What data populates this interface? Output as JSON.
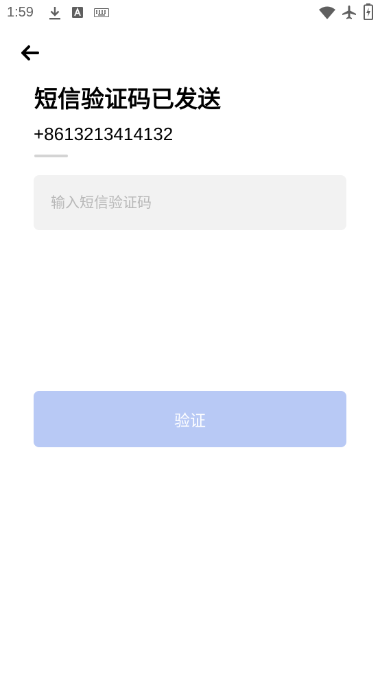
{
  "status_bar": {
    "time": "1:59",
    "icons": [
      "download-icon",
      "font-a-icon",
      "keyboard-icon",
      "wifi-icon",
      "airplane-icon",
      "battery-charging-icon"
    ]
  },
  "header": {
    "back_icon": "arrow-left-icon"
  },
  "main": {
    "title": "短信验证码已发送",
    "phone": "+8613213414132",
    "code_input": {
      "placeholder": "输入短信验证码",
      "value": ""
    },
    "verify_label": "验证"
  },
  "colors": {
    "button_disabled": "#b8c9f5",
    "input_bg": "#f2f2f2",
    "underline": "#d4d4d4"
  }
}
